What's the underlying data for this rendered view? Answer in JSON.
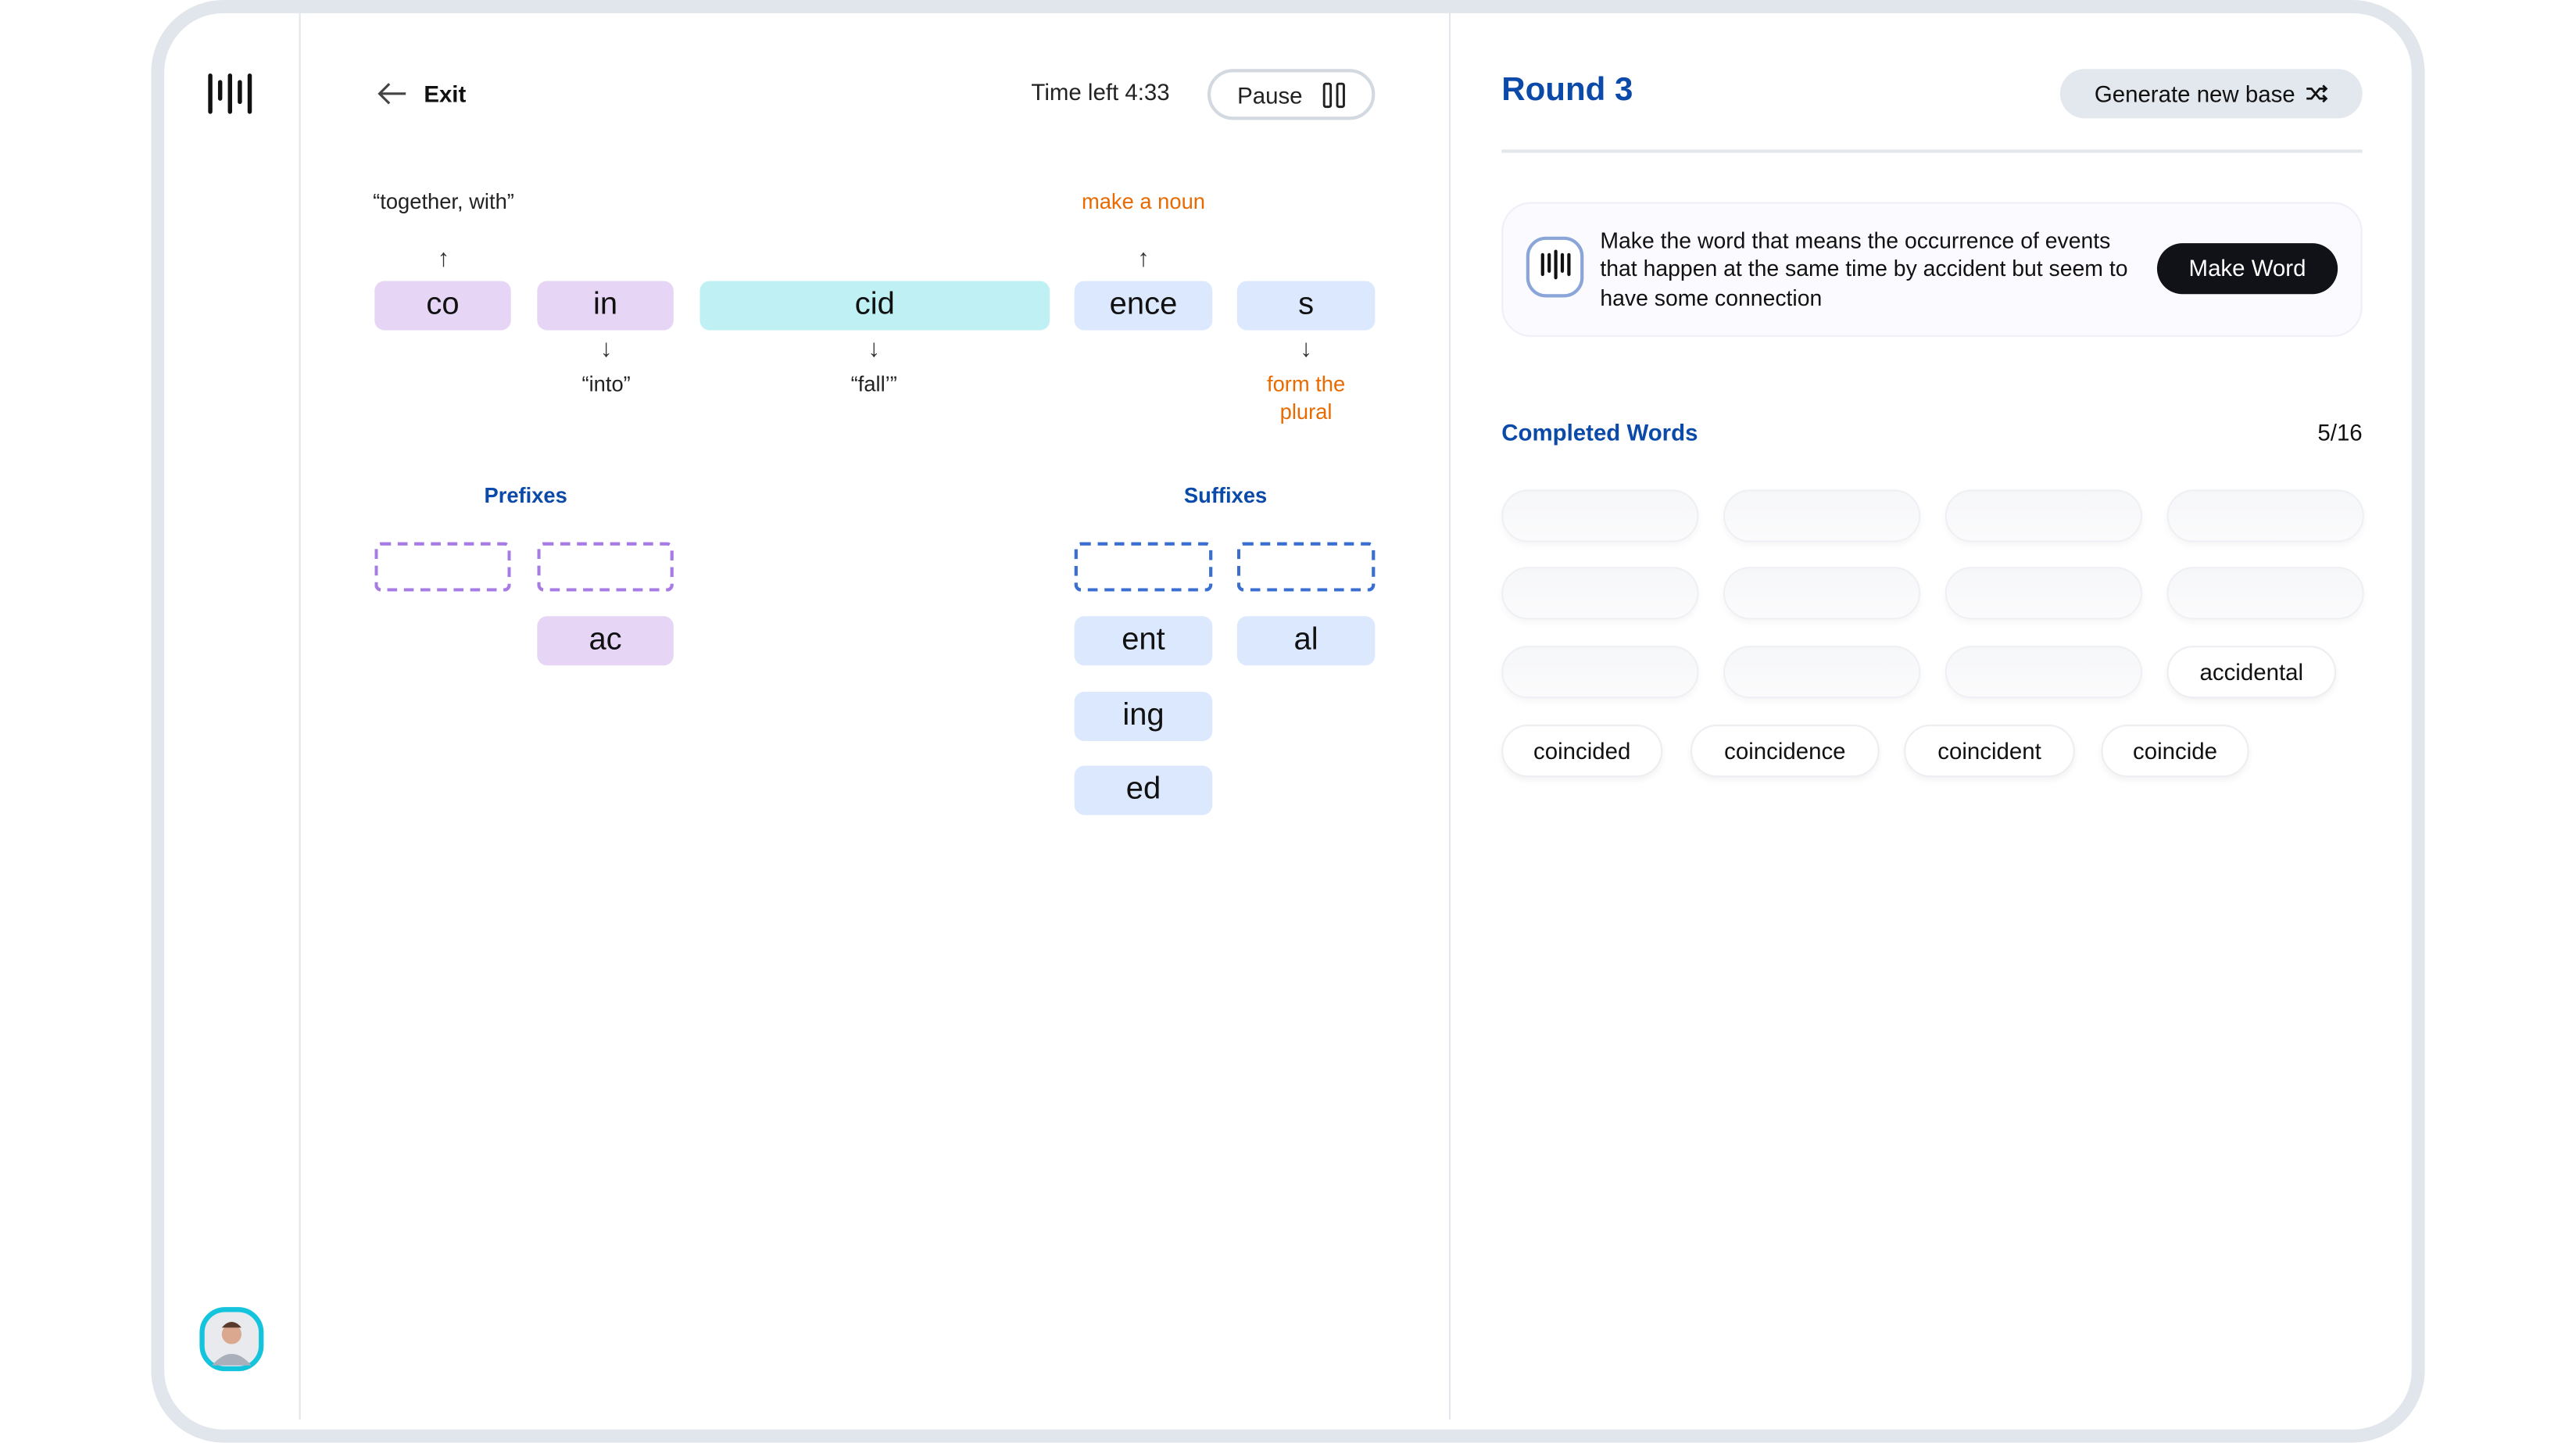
{
  "header": {
    "exit_label": "Exit",
    "time_left": "Time left 4:33",
    "pause_label": "Pause"
  },
  "word_parts": [
    {
      "text": "co",
      "type": "prefix",
      "meaning": "“together, with”",
      "meaning_position": "above"
    },
    {
      "text": "in",
      "type": "prefix",
      "meaning": "“into”",
      "meaning_position": "below"
    },
    {
      "text": "cid",
      "type": "base",
      "meaning": "“fall’”",
      "meaning_position": "below"
    },
    {
      "text": "ence",
      "type": "suffix",
      "meaning": "make a noun",
      "meaning_position": "above"
    },
    {
      "text": "s",
      "type": "suffix",
      "meaning": "form the plural",
      "meaning_position": "below"
    }
  ],
  "prefixes": {
    "label": "Prefixes",
    "options": [
      "ac"
    ]
  },
  "suffixes": {
    "label": "Suffixes",
    "options": [
      "ent",
      "al",
      "ing",
      "ed"
    ]
  },
  "right": {
    "round_title": "Round 3",
    "generate_label": "Generate new base",
    "prompt_text": "Make the word that means the occurrence of events that happen at the same time by accident but seem to have some connection",
    "make_word_label": "Make Word",
    "completed_label": "Completed Words",
    "completed_count": "5/16",
    "completed_words": [
      "accidental",
      "coincided",
      "coincidence",
      "coincident",
      "coincide"
    ]
  },
  "colors": {
    "accent_blue": "#0b4aa8",
    "orange": "#e86a00",
    "prefix": "#e6d5f5",
    "base": "#bff0f3",
    "suffix": "#dbe8fd",
    "avatar_ring": "#14c3dc"
  }
}
